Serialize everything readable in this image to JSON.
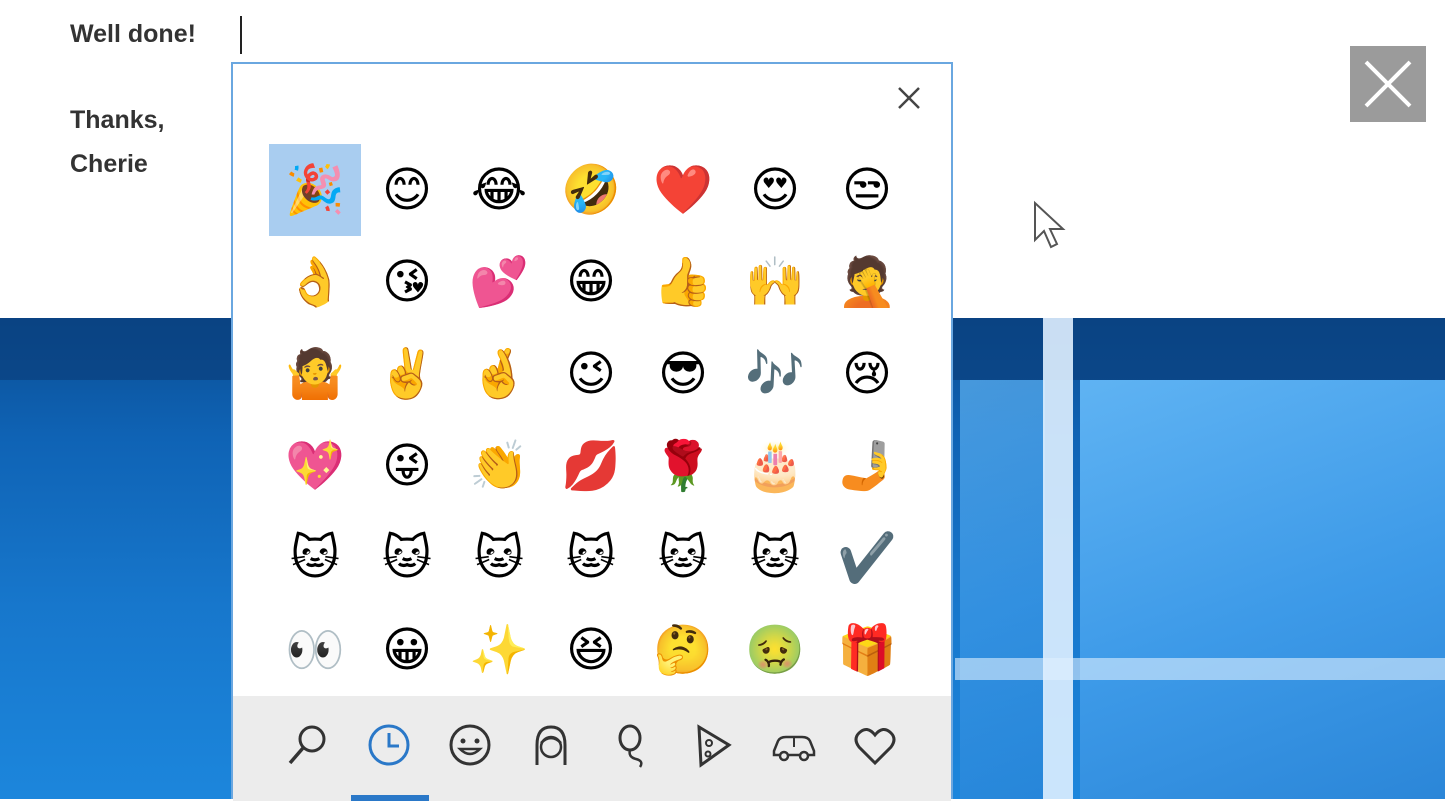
{
  "message": {
    "line1": "Well done!",
    "line2": "Thanks,",
    "line3": "Cherie"
  },
  "emoji_panel": {
    "close_glyph": "×",
    "selected_index": 0,
    "grid": [
      [
        "🎉",
        "😊",
        "😂",
        "🤣",
        "❤️",
        "😍",
        "😒"
      ],
      [
        "👌",
        "😘",
        "💕",
        "😁",
        "👍",
        "🙌",
        "🤦"
      ],
      [
        "🤷",
        "✌️",
        "🤞",
        "😉",
        "😎",
        "🎶",
        "😢"
      ],
      [
        "💖",
        "😜",
        "👏",
        "💋",
        "🌹",
        "🎂",
        "🤳"
      ],
      [
        "🐱",
        "🐱",
        "🐱",
        "🐱",
        "🐱",
        "🐱",
        "✔️"
      ],
      [
        "👀",
        "😀",
        "✨",
        "😆",
        "🤔",
        "🤢",
        "🎁"
      ]
    ],
    "tabs": [
      {
        "name": "search-icon",
        "glyph": ""
      },
      {
        "name": "recent-clock-icon",
        "glyph": ""
      },
      {
        "name": "smiley-icon",
        "glyph": ""
      },
      {
        "name": "person-icon",
        "glyph": ""
      },
      {
        "name": "balloon-icon",
        "glyph": ""
      },
      {
        "name": "pizza-icon",
        "glyph": ""
      },
      {
        "name": "car-icon",
        "glyph": ""
      },
      {
        "name": "heart-icon",
        "glyph": ""
      }
    ],
    "active_tab": 1
  },
  "colors": {
    "accent": "#2a78c8",
    "selected_cell": "#a9cdf0",
    "panel_border": "#6aa7e0"
  }
}
